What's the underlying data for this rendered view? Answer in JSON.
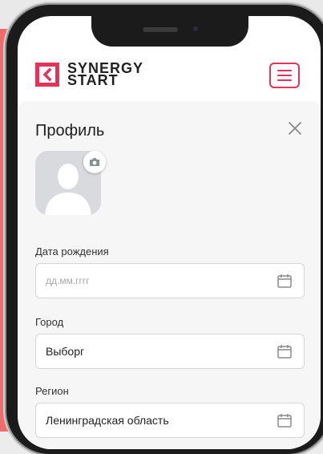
{
  "logo": {
    "line1": "SYNERGY",
    "line2": "START"
  },
  "profile": {
    "title": "Профиль",
    "fields": [
      {
        "label": "Дата рождения",
        "value": "",
        "placeholder": "дд.мм.гггг"
      },
      {
        "label": "Город",
        "value": "Выборг",
        "placeholder": ""
      },
      {
        "label": "Регион",
        "value": "Ленинградская область",
        "placeholder": ""
      }
    ]
  },
  "colors": {
    "accent": "#e0345b",
    "side_panel": "#f26a6a"
  },
  "icons": [
    "logo-mark-icon",
    "hamburger-menu-icon",
    "close-icon",
    "avatar-placeholder-icon",
    "camera-icon",
    "calendar-icon"
  ]
}
